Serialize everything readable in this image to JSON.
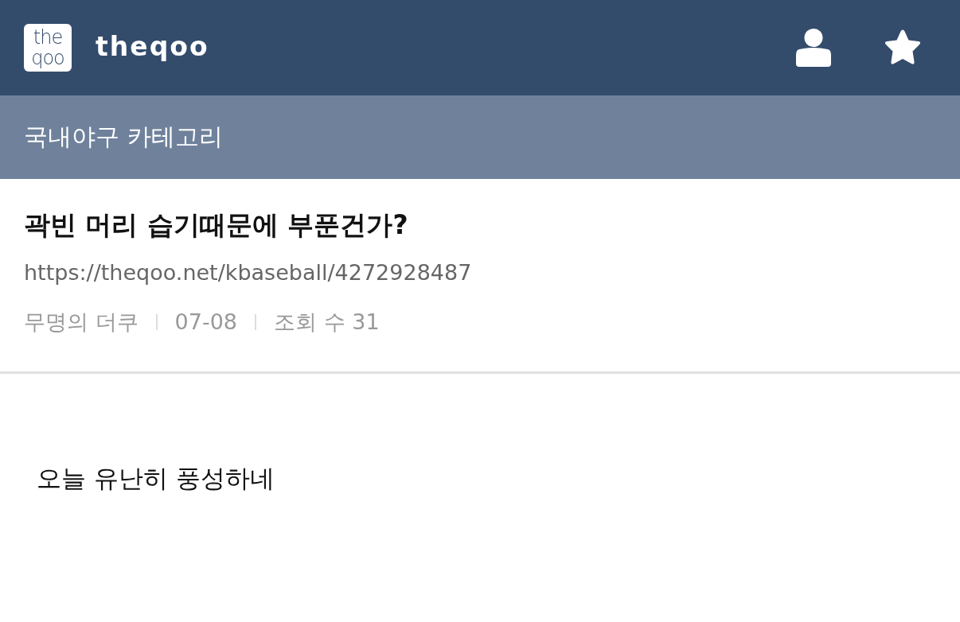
{
  "header": {
    "logo": {
      "lines": [
        "the",
        "qoo"
      ]
    },
    "site_name": "theqoo",
    "actions": [
      {
        "kind": "user"
      },
      {
        "kind": "star"
      }
    ]
  },
  "category_bar": {
    "title": "국내야구 카테고리"
  },
  "post": {
    "title": "곽빈 머리 습기때문에 부푼건가?",
    "url": "https://theqoo.net/kbaseball/4272928487",
    "meta": [
      "무명의 더쿠",
      "07-08",
      "조회 수 31"
    ],
    "body": "오늘 유난히 풍성하네"
  }
}
